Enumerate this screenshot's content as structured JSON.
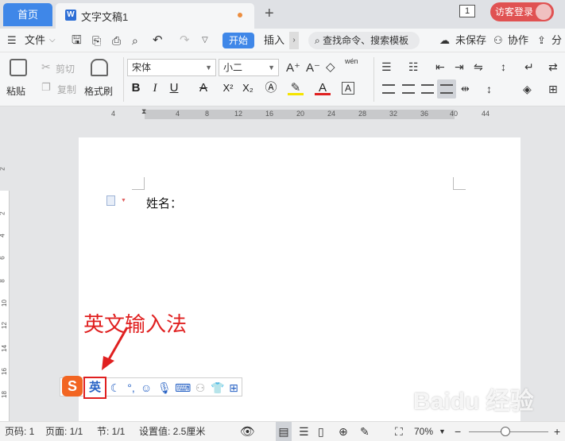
{
  "tabs": {
    "home": "首页",
    "doc_name": "文字文稿1"
  },
  "titlebar": {
    "plus": "+",
    "page_count": "1",
    "login": "访客登录"
  },
  "menu": {
    "file": "文件",
    "start": "开始",
    "insert": "插入",
    "search_placeholder": "查找命令、搜索模板",
    "unsaved": "未保存",
    "collab": "协作",
    "share": "分享"
  },
  "ribbon": {
    "paste": "粘贴",
    "cut": "剪切",
    "copy": "复制",
    "format_painter": "格式刷",
    "font": "宋体",
    "size": "小二",
    "pinyin": "wén",
    "bold": "B",
    "italic": "I",
    "underline": "U",
    "strike": "A",
    "superscript": "X²",
    "subscript": "X₂",
    "font_color": "A",
    "char_border": "A"
  },
  "ruler": {
    "numbers": [
      "4",
      "4",
      "8",
      "12",
      "16",
      "20",
      "24",
      "28",
      "32",
      "36",
      "40",
      "44"
    ]
  },
  "vruler": {
    "numbers": [
      "2",
      "2",
      "4",
      "6",
      "8",
      "10",
      "12",
      "14",
      "16",
      "18"
    ]
  },
  "document": {
    "name_label": "姓名："
  },
  "annotation": "英文输入法",
  "ime": {
    "logo": "S",
    "mode": "英"
  },
  "statusbar": {
    "page_code": "页码: 1",
    "pages": "页面: 1/1",
    "section": "节: 1/1",
    "setting": "设置值: 2.5厘米",
    "zoom": "70%"
  },
  "watermark": "Baidu 经验",
  "colors": {
    "accent": "#3f87e8",
    "annotation": "#e02020",
    "ime_logo": "#f26522"
  }
}
